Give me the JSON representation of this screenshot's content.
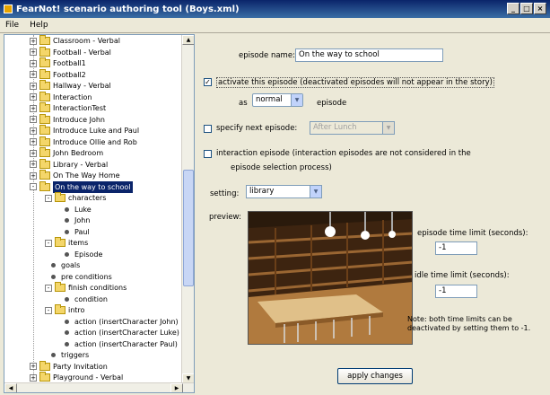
{
  "window": {
    "title": "FearNot! scenario authoring tool (Boys.xml)",
    "minimize": "_",
    "maximize": "□",
    "close": "×"
  },
  "menu": [
    "File",
    "Help"
  ],
  "tree": {
    "items": [
      {
        "label": "Classroom - Verbal",
        "type": "folder",
        "depth": 1,
        "toggle": "+"
      },
      {
        "label": "Football - Verbal",
        "type": "folder",
        "depth": 1,
        "toggle": "+"
      },
      {
        "label": "Football1",
        "type": "folder",
        "depth": 1,
        "toggle": "+"
      },
      {
        "label": "Football2",
        "type": "folder",
        "depth": 1,
        "toggle": "+"
      },
      {
        "label": "Hallway - Verbal",
        "type": "folder",
        "depth": 1,
        "toggle": "+"
      },
      {
        "label": "Interaction",
        "type": "folder",
        "depth": 1,
        "toggle": "+"
      },
      {
        "label": "InteractionTest",
        "type": "folder",
        "depth": 1,
        "toggle": "+"
      },
      {
        "label": "Introduce John",
        "type": "folder",
        "depth": 1,
        "toggle": "+"
      },
      {
        "label": "Introduce Luke and Paul",
        "type": "folder",
        "depth": 1,
        "toggle": "+"
      },
      {
        "label": "Introduce Ollie and Rob",
        "type": "folder",
        "depth": 1,
        "toggle": "+"
      },
      {
        "label": "John Bedroom",
        "type": "folder",
        "depth": 1,
        "toggle": "+"
      },
      {
        "label": "Library - Verbal",
        "type": "folder",
        "depth": 1,
        "toggle": "+"
      },
      {
        "label": "On The Way Home",
        "type": "folder",
        "depth": 1,
        "toggle": "+"
      },
      {
        "label": "On the way to school",
        "type": "folder",
        "depth": 1,
        "toggle": "-",
        "selected": true
      },
      {
        "label": "characters",
        "type": "folder",
        "depth": 2,
        "toggle": "-"
      },
      {
        "label": "Luke",
        "type": "leaf",
        "depth": 3
      },
      {
        "label": "John",
        "type": "leaf",
        "depth": 3
      },
      {
        "label": "Paul",
        "type": "leaf",
        "depth": 3
      },
      {
        "label": "items",
        "type": "folder",
        "depth": 2,
        "toggle": "-"
      },
      {
        "label": "Episode",
        "type": "leaf",
        "depth": 3
      },
      {
        "label": "goals",
        "type": "leaf",
        "depth": 2
      },
      {
        "label": "pre conditions",
        "type": "leaf",
        "depth": 2
      },
      {
        "label": "finish conditions",
        "type": "folder",
        "depth": 2,
        "toggle": "-"
      },
      {
        "label": "condition",
        "type": "leaf",
        "depth": 3
      },
      {
        "label": "intro",
        "type": "folder",
        "depth": 2,
        "toggle": "-"
      },
      {
        "label": "action (insertCharacter John)",
        "type": "leaf",
        "depth": 3
      },
      {
        "label": "action (insertCharacter Luke)",
        "type": "leaf",
        "depth": 3
      },
      {
        "label": "action (insertCharacter Paul)",
        "type": "leaf",
        "depth": 3
      },
      {
        "label": "triggers",
        "type": "leaf",
        "depth": 2
      },
      {
        "label": "Party Invitation",
        "type": "folder",
        "depth": 1,
        "toggle": "+"
      },
      {
        "label": "Playground - Verbal",
        "type": "folder",
        "depth": 1,
        "toggle": "+"
      }
    ]
  },
  "form": {
    "episode_name_label": "episode name:",
    "episode_name_value": "On the way to school",
    "activate_label": "activate this episode (deactivated episodes will not appear in the story)",
    "activate_checked": true,
    "as_label": "as",
    "as_value": "normal",
    "episode_suffix": "episode",
    "specify_next_label": "specify next episode:",
    "specify_next_checked": false,
    "next_episode_value": "After Lunch",
    "interaction_label_1": "interaction episode (interaction episodes are not considered in the",
    "interaction_label_2": "episode selection process)",
    "interaction_checked": false,
    "setting_label": "setting:",
    "setting_value": "library",
    "preview_label": "preview:",
    "episode_time_label": "episode time limit (seconds):",
    "episode_time_value": "-1",
    "idle_time_label": "idle time limit (seconds):",
    "idle_time_value": "-1",
    "note_1": "Note: both time limits can be",
    "note_2": "deactivated by setting them to -1.",
    "apply_button": "apply changes",
    "check_mark": "✓"
  },
  "scroll": {
    "up": "▲",
    "down": "▼",
    "left": "◀",
    "right": "▶"
  },
  "combo_arrow": "▼"
}
